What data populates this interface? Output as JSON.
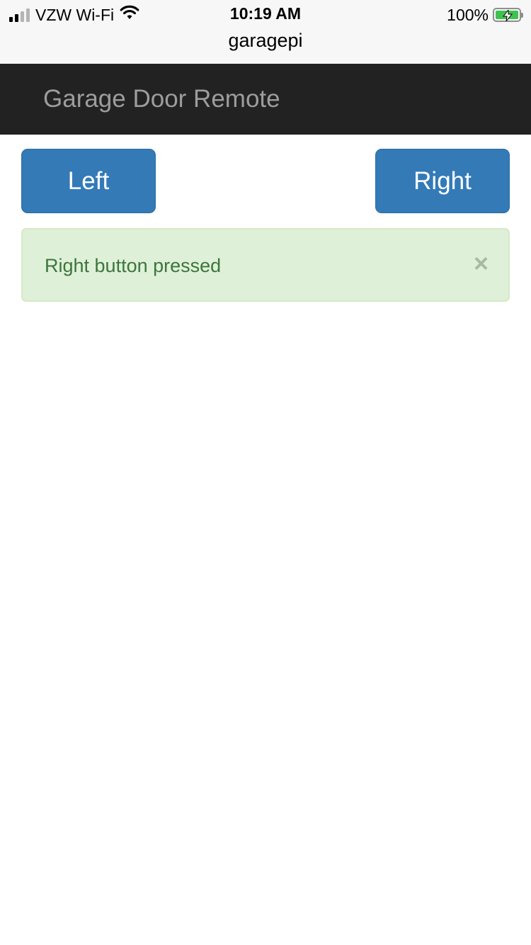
{
  "status_bar": {
    "carrier": "VZW Wi-Fi",
    "time": "10:19 AM",
    "battery_percent": "100%",
    "battery_level": 1.0,
    "signal_bars_active": 2,
    "signal_bars_total": 4,
    "icons": [
      "signal-icon",
      "wifi-icon",
      "battery-charging-icon"
    ]
  },
  "browser": {
    "page_title": "garagepi"
  },
  "navbar": {
    "brand": "Garage Door Remote",
    "background": "#222222"
  },
  "buttons": {
    "left_label": "Left",
    "right_label": "Right",
    "color": "#337ab7"
  },
  "alert": {
    "message": "Right button pressed",
    "close_glyph": "×",
    "background": "#dff0d8",
    "text_color": "#3c763d"
  }
}
